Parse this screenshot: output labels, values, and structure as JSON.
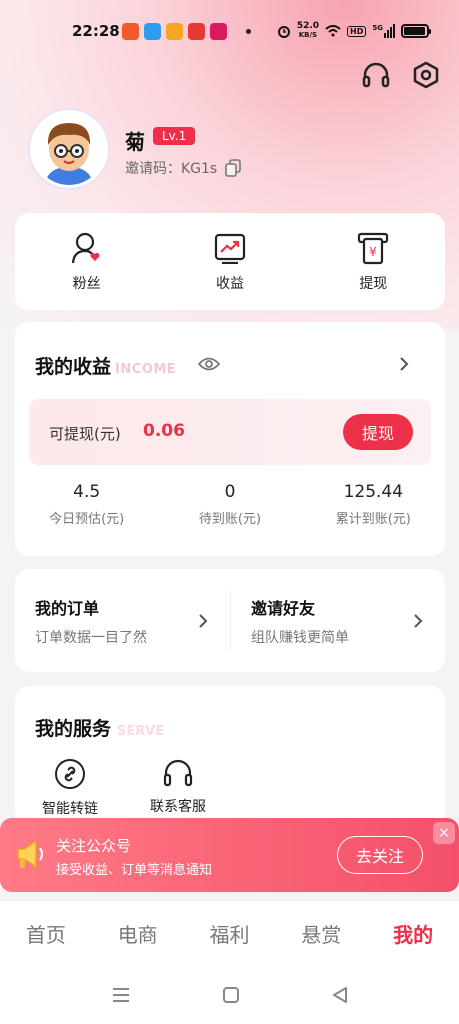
{
  "status_bar": {
    "time": "22:28",
    "net_speed": "52.0",
    "net_unit": "KB/S",
    "hd": "HD",
    "signal": "5G",
    "battery_level": 0.95
  },
  "profile": {
    "name": "菊",
    "level": "Lv.1",
    "invite_label": "邀请码：",
    "invite_code": "KG1s"
  },
  "quick_actions": [
    {
      "label": "粉丝",
      "icon": "fans-icon"
    },
    {
      "label": "收益",
      "icon": "earnings-icon"
    },
    {
      "label": "提现",
      "icon": "withdraw-icon"
    }
  ],
  "income": {
    "title": "我的收益",
    "title_en": "INCOME",
    "withdrawable_label": "可提现(元)",
    "withdrawable_value": "0.06",
    "withdraw_button": "提现",
    "stats": [
      {
        "value": "4.5",
        "label": "今日预估(元)"
      },
      {
        "value": "0",
        "label": "待到账(元)"
      },
      {
        "value": "125.44",
        "label": "累计到账(元)"
      }
    ]
  },
  "orders": {
    "my_orders_title": "我的订单",
    "my_orders_sub": "订单数据一目了然",
    "invite_title": "邀请好友",
    "invite_sub": "组队赚钱更简单"
  },
  "services": {
    "title": "我的服务",
    "title_en": "SERVE",
    "items": [
      {
        "label": "智能转链",
        "icon": "link-icon"
      },
      {
        "label": "联系客服",
        "icon": "headset-icon"
      }
    ]
  },
  "banner": {
    "title": "关注公众号",
    "subtitle": "接受收益、订单等消息通知",
    "button": "去关注",
    "close": "×"
  },
  "tabs": [
    {
      "label": "首页",
      "active": false
    },
    {
      "label": "电商",
      "active": false
    },
    {
      "label": "福利",
      "active": false
    },
    {
      "label": "悬赏",
      "active": false
    },
    {
      "label": "我的",
      "active": true
    }
  ],
  "colors": {
    "accent": "#ee2f48",
    "banner_start": "#ff7a86",
    "banner_end": "#f4506a"
  }
}
